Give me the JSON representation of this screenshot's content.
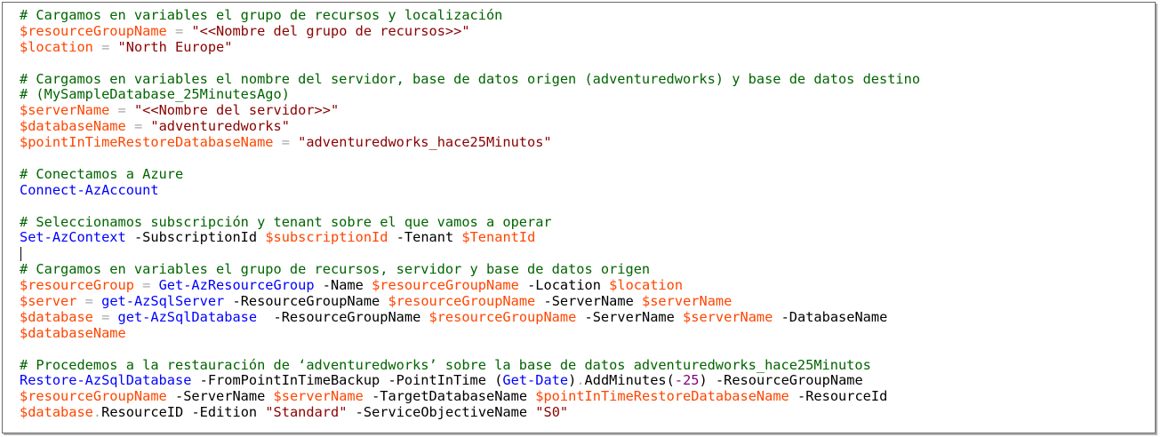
{
  "colors": {
    "comment": "#006400",
    "variable": "#FF4500",
    "string": "#8B0000",
    "command": "#0000FF",
    "parameter": "#000080",
    "operator": "#A9A9A9",
    "number": "#800080",
    "member": "#000000",
    "background": "#FFFFFF"
  },
  "code_lines": [
    [
      {
        "t": "comment",
        "v": "# Cargamos en variables el grupo de recursos y localización"
      }
    ],
    [
      {
        "t": "variable",
        "v": "$resourceGroupName"
      },
      {
        "t": "operator",
        "v": " = "
      },
      {
        "t": "string",
        "v": "\"<<Nombre del grupo de recursos>>\""
      }
    ],
    [
      {
        "t": "variable",
        "v": "$location"
      },
      {
        "t": "operator",
        "v": " = "
      },
      {
        "t": "string",
        "v": "\"North Europe\""
      }
    ],
    [],
    [
      {
        "t": "comment",
        "v": "# Cargamos en variables el nombre del servidor, base de datos origen (adventuredworks) y base de datos destino"
      }
    ],
    [
      {
        "t": "comment",
        "v": "# (MySampleDatabase_25MinutesAgo)"
      }
    ],
    [
      {
        "t": "variable",
        "v": "$serverName"
      },
      {
        "t": "operator",
        "v": " = "
      },
      {
        "t": "string",
        "v": "\"<<Nombre del servidor>>\""
      }
    ],
    [
      {
        "t": "variable",
        "v": "$databaseName"
      },
      {
        "t": "operator",
        "v": " = "
      },
      {
        "t": "string",
        "v": "\"adventuredworks\""
      }
    ],
    [
      {
        "t": "variable",
        "v": "$pointInTimeRestoreDatabaseName"
      },
      {
        "t": "operator",
        "v": " = "
      },
      {
        "t": "string",
        "v": "\"adventuredworks_hace25Minutos\""
      }
    ],
    [],
    [
      {
        "t": "comment",
        "v": "# Conectamos a Azure"
      }
    ],
    [
      {
        "t": "command",
        "v": "Connect-AzAccount"
      }
    ],
    [],
    [
      {
        "t": "comment",
        "v": "# Seleccionamos subscripción y tenant sobre el que vamos a operar"
      }
    ],
    [
      {
        "t": "command",
        "v": "Set-AzContext"
      },
      {
        "t": "plain",
        "v": " "
      },
      {
        "t": "parameter",
        "v": "-SubscriptionId"
      },
      {
        "t": "plain",
        "v": " "
      },
      {
        "t": "variable",
        "v": "$subscriptionId"
      },
      {
        "t": "plain",
        "v": " "
      },
      {
        "t": "parameter",
        "v": "-Tenant"
      },
      {
        "t": "plain",
        "v": " "
      },
      {
        "t": "variable",
        "v": "$TenantId"
      }
    ],
    [
      {
        "t": "caret",
        "v": ""
      }
    ],
    [
      {
        "t": "comment",
        "v": "# Cargamos en variables el grupo de recursos, servidor y base de datos origen"
      }
    ],
    [
      {
        "t": "variable",
        "v": "$resourceGroup"
      },
      {
        "t": "operator",
        "v": " = "
      },
      {
        "t": "command",
        "v": "Get-AzResourceGroup"
      },
      {
        "t": "plain",
        "v": " "
      },
      {
        "t": "parameter",
        "v": "-Name"
      },
      {
        "t": "plain",
        "v": " "
      },
      {
        "t": "variable",
        "v": "$resourceGroupName"
      },
      {
        "t": "plain",
        "v": " "
      },
      {
        "t": "parameter",
        "v": "-Location"
      },
      {
        "t": "plain",
        "v": " "
      },
      {
        "t": "variable",
        "v": "$location"
      }
    ],
    [
      {
        "t": "variable",
        "v": "$server"
      },
      {
        "t": "operator",
        "v": " = "
      },
      {
        "t": "command",
        "v": "get-AzSqlServer"
      },
      {
        "t": "plain",
        "v": " "
      },
      {
        "t": "parameter",
        "v": "-ResourceGroupName"
      },
      {
        "t": "plain",
        "v": " "
      },
      {
        "t": "variable",
        "v": "$resourceGroupName"
      },
      {
        "t": "plain",
        "v": " "
      },
      {
        "t": "parameter",
        "v": "-ServerName"
      },
      {
        "t": "plain",
        "v": " "
      },
      {
        "t": "variable",
        "v": "$serverName"
      }
    ],
    [
      {
        "t": "variable",
        "v": "$database"
      },
      {
        "t": "operator",
        "v": " = "
      },
      {
        "t": "command",
        "v": "get-AzSqlDatabase"
      },
      {
        "t": "plain",
        "v": "  "
      },
      {
        "t": "parameter",
        "v": "-ResourceGroupName"
      },
      {
        "t": "plain",
        "v": " "
      },
      {
        "t": "variable",
        "v": "$resourceGroupName"
      },
      {
        "t": "plain",
        "v": " "
      },
      {
        "t": "parameter",
        "v": "-ServerName"
      },
      {
        "t": "plain",
        "v": " "
      },
      {
        "t": "variable",
        "v": "$serverName"
      },
      {
        "t": "plain",
        "v": " "
      },
      {
        "t": "parameter",
        "v": "-DatabaseName"
      }
    ],
    [
      {
        "t": "variable",
        "v": "$databaseName"
      }
    ],
    [],
    [
      {
        "t": "comment",
        "v": "# Procedemos a la restauración de ‘adventuredworks’ sobre la base de datos adventuredworks_hace25Minutos"
      }
    ],
    [
      {
        "t": "command",
        "v": "Restore-AzSqlDatabase"
      },
      {
        "t": "plain",
        "v": " "
      },
      {
        "t": "parameter",
        "v": "-FromPointInTimeBackup"
      },
      {
        "t": "plain",
        "v": " "
      },
      {
        "t": "parameter",
        "v": "-PointInTime"
      },
      {
        "t": "plain",
        "v": " "
      },
      {
        "t": "plain",
        "v": "("
      },
      {
        "t": "command",
        "v": "Get-Date"
      },
      {
        "t": "plain",
        "v": ")"
      },
      {
        "t": "operator",
        "v": "."
      },
      {
        "t": "member",
        "v": "AddMinutes"
      },
      {
        "t": "plain",
        "v": "("
      },
      {
        "t": "number",
        "v": "-25"
      },
      {
        "t": "plain",
        "v": ") "
      },
      {
        "t": "parameter",
        "v": "-ResourceGroupName"
      }
    ],
    [
      {
        "t": "variable",
        "v": "$resourceGroupName"
      },
      {
        "t": "plain",
        "v": " "
      },
      {
        "t": "parameter",
        "v": "-ServerName"
      },
      {
        "t": "plain",
        "v": " "
      },
      {
        "t": "variable",
        "v": "$serverName"
      },
      {
        "t": "plain",
        "v": " "
      },
      {
        "t": "parameter",
        "v": "-TargetDatabaseName"
      },
      {
        "t": "plain",
        "v": " "
      },
      {
        "t": "variable",
        "v": "$pointInTimeRestoreDatabaseName"
      },
      {
        "t": "plain",
        "v": " "
      },
      {
        "t": "parameter",
        "v": "-ResourceId"
      }
    ],
    [
      {
        "t": "variable",
        "v": "$database"
      },
      {
        "t": "operator",
        "v": "."
      },
      {
        "t": "member",
        "v": "ResourceID"
      },
      {
        "t": "plain",
        "v": " "
      },
      {
        "t": "parameter",
        "v": "-Edition"
      },
      {
        "t": "plain",
        "v": " "
      },
      {
        "t": "string",
        "v": "\"Standard\""
      },
      {
        "t": "plain",
        "v": " "
      },
      {
        "t": "parameter",
        "v": "-ServiceObjectiveName"
      },
      {
        "t": "plain",
        "v": " "
      },
      {
        "t": "string",
        "v": "\"S0\""
      }
    ]
  ]
}
